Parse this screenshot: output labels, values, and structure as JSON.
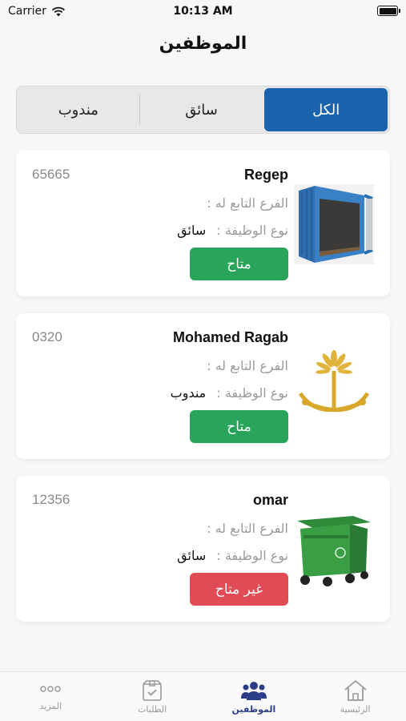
{
  "status_bar": {
    "carrier": "Carrier",
    "time": "10:13 AM"
  },
  "page": {
    "title": "الموظفين"
  },
  "filter_tabs": [
    {
      "label": "الكل",
      "active": true
    },
    {
      "label": "سائق",
      "active": false
    },
    {
      "label": "مندوب",
      "active": false
    }
  ],
  "employees": [
    {
      "name": "Regep",
      "number": "65665",
      "branch_label": "الفرع التابع له :",
      "branch_value": "",
      "job_label": "نوع الوظيفة :",
      "job_value": "سائق",
      "status": "متاح",
      "available": true,
      "image_icon": "container-icon"
    },
    {
      "name": "Mohamed Ragab",
      "number": "0320",
      "branch_label": "الفرع التابع له :",
      "branch_value": "",
      "job_label": "نوع الوظيفة :",
      "job_value": "مندوب",
      "status": "متاح",
      "available": true,
      "image_icon": "saudi-emblem-icon"
    },
    {
      "name": "omar",
      "number": "12356",
      "branch_label": "الفرع التابع له :",
      "branch_value": "",
      "job_label": "نوع الوظيفة :",
      "job_value": "سائق",
      "status": "غير متاح",
      "available": false,
      "image_icon": "waste-bin-icon"
    }
  ],
  "tabbar": [
    {
      "label": "المزيد",
      "icon": "more-icon",
      "active": false
    },
    {
      "label": "الطلبات",
      "icon": "orders-box-icon",
      "active": false
    },
    {
      "label": "الموظفين",
      "icon": "users-icon",
      "active": true
    },
    {
      "label": "الرئيسية",
      "icon": "home-icon",
      "active": false
    }
  ],
  "colors": {
    "primary": "#1a64ad",
    "available": "#28a55a",
    "unavailable": "#e04b55",
    "tab_active": "#2b3d86"
  }
}
